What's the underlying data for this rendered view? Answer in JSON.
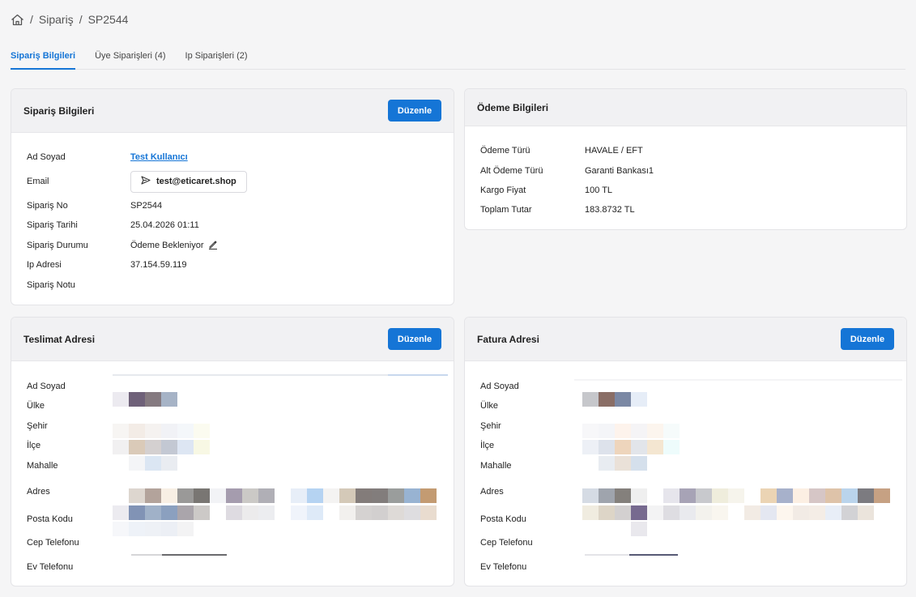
{
  "breadcrumb": {
    "items": [
      "Sipariş",
      "SP2544"
    ],
    "separator": "/"
  },
  "tabs": [
    {
      "label": "Sipariş Bilgileri",
      "active": true
    },
    {
      "label": "Üye Siparişleri (4)",
      "active": false
    },
    {
      "label": "Ip Siparişleri (2)",
      "active": false
    }
  ],
  "order_card": {
    "title": "Sipariş Bilgileri",
    "edit_label": "Düzenle",
    "fields": {
      "name": {
        "label": "Ad Soyad",
        "value": "Test Kullanıcı"
      },
      "email": {
        "label": "Email",
        "value": "test@eticaret.shop"
      },
      "order_no": {
        "label": "Sipariş No",
        "value": "SP2544"
      },
      "order_date": {
        "label": "Sipariş Tarihi",
        "value": "25.04.2026 01:11"
      },
      "status": {
        "label": "Sipariş Durumu",
        "value": "Ödeme Bekleniyor"
      },
      "ip": {
        "label": "Ip Adresi",
        "value": "37.154.59.119"
      },
      "note": {
        "label": "Sipariş Notu",
        "value": ""
      }
    }
  },
  "payment_card": {
    "title": "Ödeme Bilgileri",
    "fields": {
      "type": {
        "label": "Ödeme Türü",
        "value": "HAVALE / EFT"
      },
      "sub_type": {
        "label": "Alt Ödeme Türü",
        "value": "Garanti Bankası1"
      },
      "shipping": {
        "label": "Kargo Fiyat",
        "value": "100 TL"
      },
      "total": {
        "label": "Toplam Tutar",
        "value": "183.8732 TL"
      }
    }
  },
  "delivery_card": {
    "title": "Teslimat Adresi",
    "edit_label": "Düzenle",
    "labels": [
      "Ad Soyad",
      "Ülke",
      "Şehir",
      "İlçe",
      "Mahalle",
      "Adres",
      "Posta Kodu",
      "Cep Telefonu",
      "Ev Telefonu"
    ]
  },
  "billing_card": {
    "title": "Fatura Adresi",
    "edit_label": "Düzenle",
    "labels": [
      "Ad Soyad",
      "Ülke",
      "Şehir",
      "İlçe",
      "Mahalle",
      "Adres",
      "Posta Kodu",
      "Cep Telefonu",
      "Ev Telefonu"
    ]
  },
  "colors": {
    "accent": "#1575d6",
    "background": "#f5f5f6",
    "card_header": "#f1f1f3"
  },
  "icons": [
    "home-icon",
    "send-icon",
    "pencil-icon"
  ]
}
